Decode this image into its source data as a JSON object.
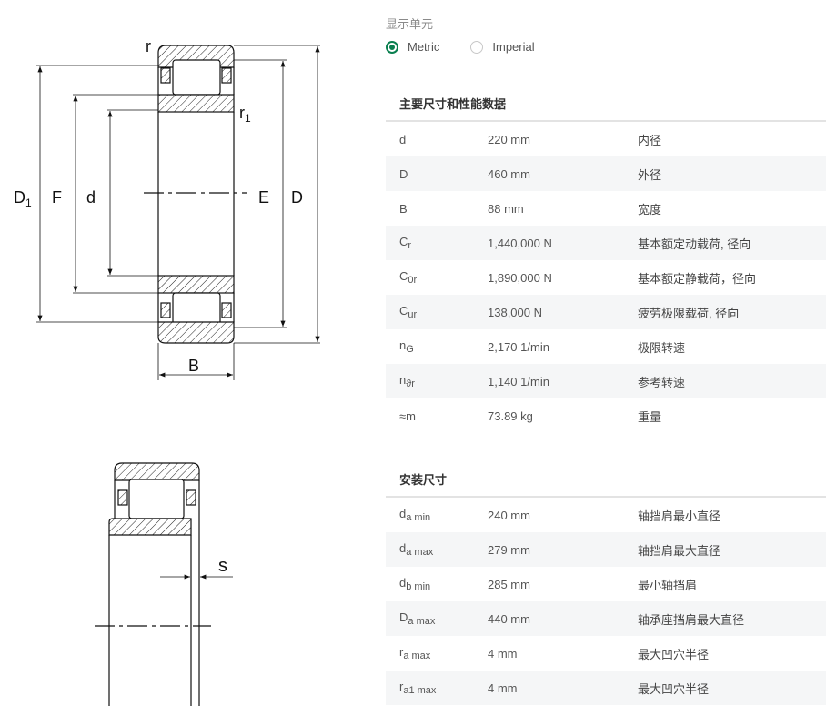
{
  "units": {
    "title": "显示单元",
    "options": [
      {
        "label": "Metric",
        "selected": true
      },
      {
        "label": "Imperial",
        "selected": false
      }
    ]
  },
  "drawing_labels": {
    "r": "r",
    "r1_base": "r",
    "r1_sub": "1",
    "D1_base": "D",
    "D1_sub": "1",
    "F": "F",
    "d": "d",
    "E": "E",
    "D": "D",
    "B": "B",
    "s": "s"
  },
  "main_section": {
    "title": "主要尺寸和性能数据",
    "rows": [
      {
        "sym": "d",
        "sub": "",
        "value": "220 mm",
        "desc": "内径"
      },
      {
        "sym": "D",
        "sub": "",
        "value": "460 mm",
        "desc": "外径"
      },
      {
        "sym": "B",
        "sub": "",
        "value": "88 mm",
        "desc": "宽度"
      },
      {
        "sym": "C",
        "sub": "r",
        "value": "1,440,000 N",
        "desc": "基本额定动载荷, 径向"
      },
      {
        "sym": "C",
        "sub": "0r",
        "value": "1,890,000 N",
        "desc": "基本额定静载荷，径向"
      },
      {
        "sym": "C",
        "sub": "ur",
        "value": "138,000 N",
        "desc": "疲劳极限载荷, 径向"
      },
      {
        "sym": "n",
        "sub": "G",
        "value": "2,170 1/min",
        "desc": "极限转速"
      },
      {
        "sym": "n",
        "sub": "ϑr",
        "value": "1,140 1/min",
        "desc": "参考转速"
      },
      {
        "sym": "≈m",
        "sub": "",
        "value": "73.89 kg",
        "desc": "重量"
      }
    ]
  },
  "mount_section": {
    "title": "安装尺寸",
    "rows": [
      {
        "sym": "d",
        "sub": "a min",
        "value": "240 mm",
        "desc": "轴挡肩最小直径"
      },
      {
        "sym": "d",
        "sub": "a max",
        "value": "279 mm",
        "desc": "轴挡肩最大直径"
      },
      {
        "sym": "d",
        "sub": "b min",
        "value": "285 mm",
        "desc": "最小轴挡肩"
      },
      {
        "sym": "D",
        "sub": "a max",
        "value": "440 mm",
        "desc": "轴承座挡肩最大直径"
      },
      {
        "sym": "r",
        "sub": "a max",
        "value": "4 mm",
        "desc": "最大凹穴半径"
      },
      {
        "sym": "r",
        "sub": "a1 max",
        "value": "4 mm",
        "desc": "最大凹穴半径"
      }
    ]
  }
}
